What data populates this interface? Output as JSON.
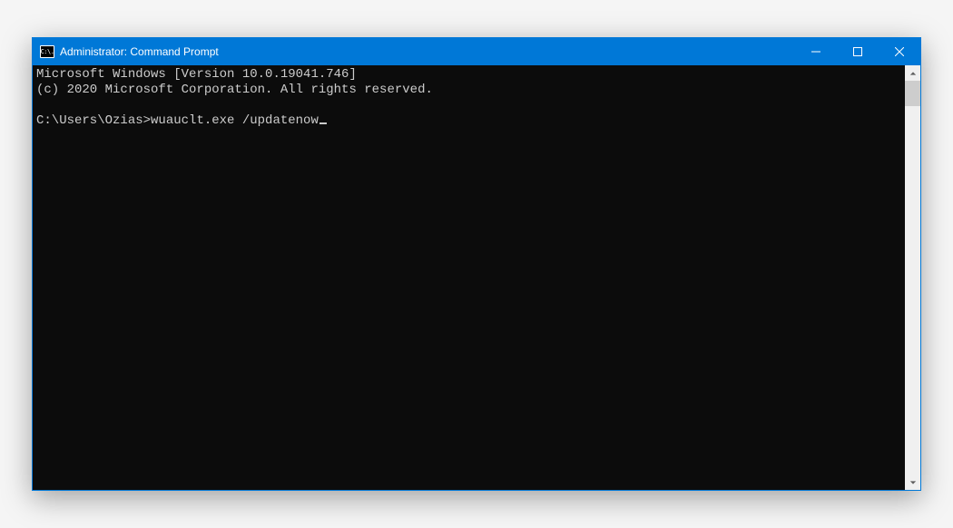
{
  "window": {
    "title": "Administrator: Command Prompt",
    "icon_label": "C:\\."
  },
  "terminal": {
    "line1": "Microsoft Windows [Version 10.0.19041.746]",
    "line2": "(c) 2020 Microsoft Corporation. All rights reserved.",
    "blank": "",
    "prompt": "C:\\Users\\Ozias>",
    "command": "wuauclt.exe /updatenow"
  }
}
